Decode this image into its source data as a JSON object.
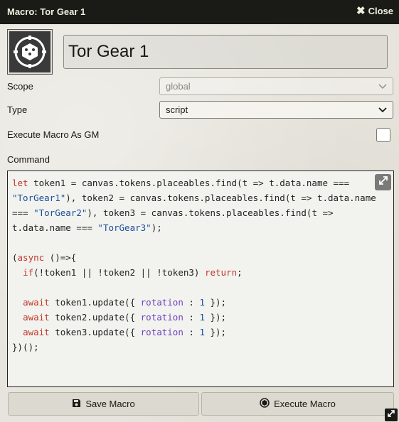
{
  "window": {
    "title": "Macro: Tor Gear 1",
    "close_label": "Close"
  },
  "macro": {
    "name": "Tor Gear 1"
  },
  "fields": {
    "scope_label": "Scope",
    "scope_value": "global",
    "type_label": "Type",
    "type_value": "script",
    "execute_as_gm_label": "Execute Macro As GM",
    "execute_as_gm_checked": false,
    "command_label": "Command"
  },
  "command": {
    "lines": [
      "let token1 = canvas.tokens.placeables.find(t => t.data.name ===",
      "\"TorGear1\"), token2 = canvas.tokens.placeables.find(t => t.data.name",
      "=== \"TorGear2\"), token3 = canvas.tokens.placeables.find(t =>",
      "t.data.name === \"TorGear3\");",
      "",
      "(async ()=>{",
      "  if(!token1 || !token2 || !token3) return;",
      "",
      "  await token1.update({ rotation : 1 });",
      "  await token2.update({ rotation : 1 });",
      "  await token3.update({ rotation : 1 });",
      "})();"
    ]
  },
  "buttons": {
    "save_label": "Save Macro",
    "execute_label": "Execute Macro"
  },
  "icons": {
    "close": "close-icon",
    "avatar": "dice-icon",
    "expand": "expand-icon",
    "save": "save-icon",
    "execute": "dice-icon",
    "resize": "resize-icon"
  }
}
